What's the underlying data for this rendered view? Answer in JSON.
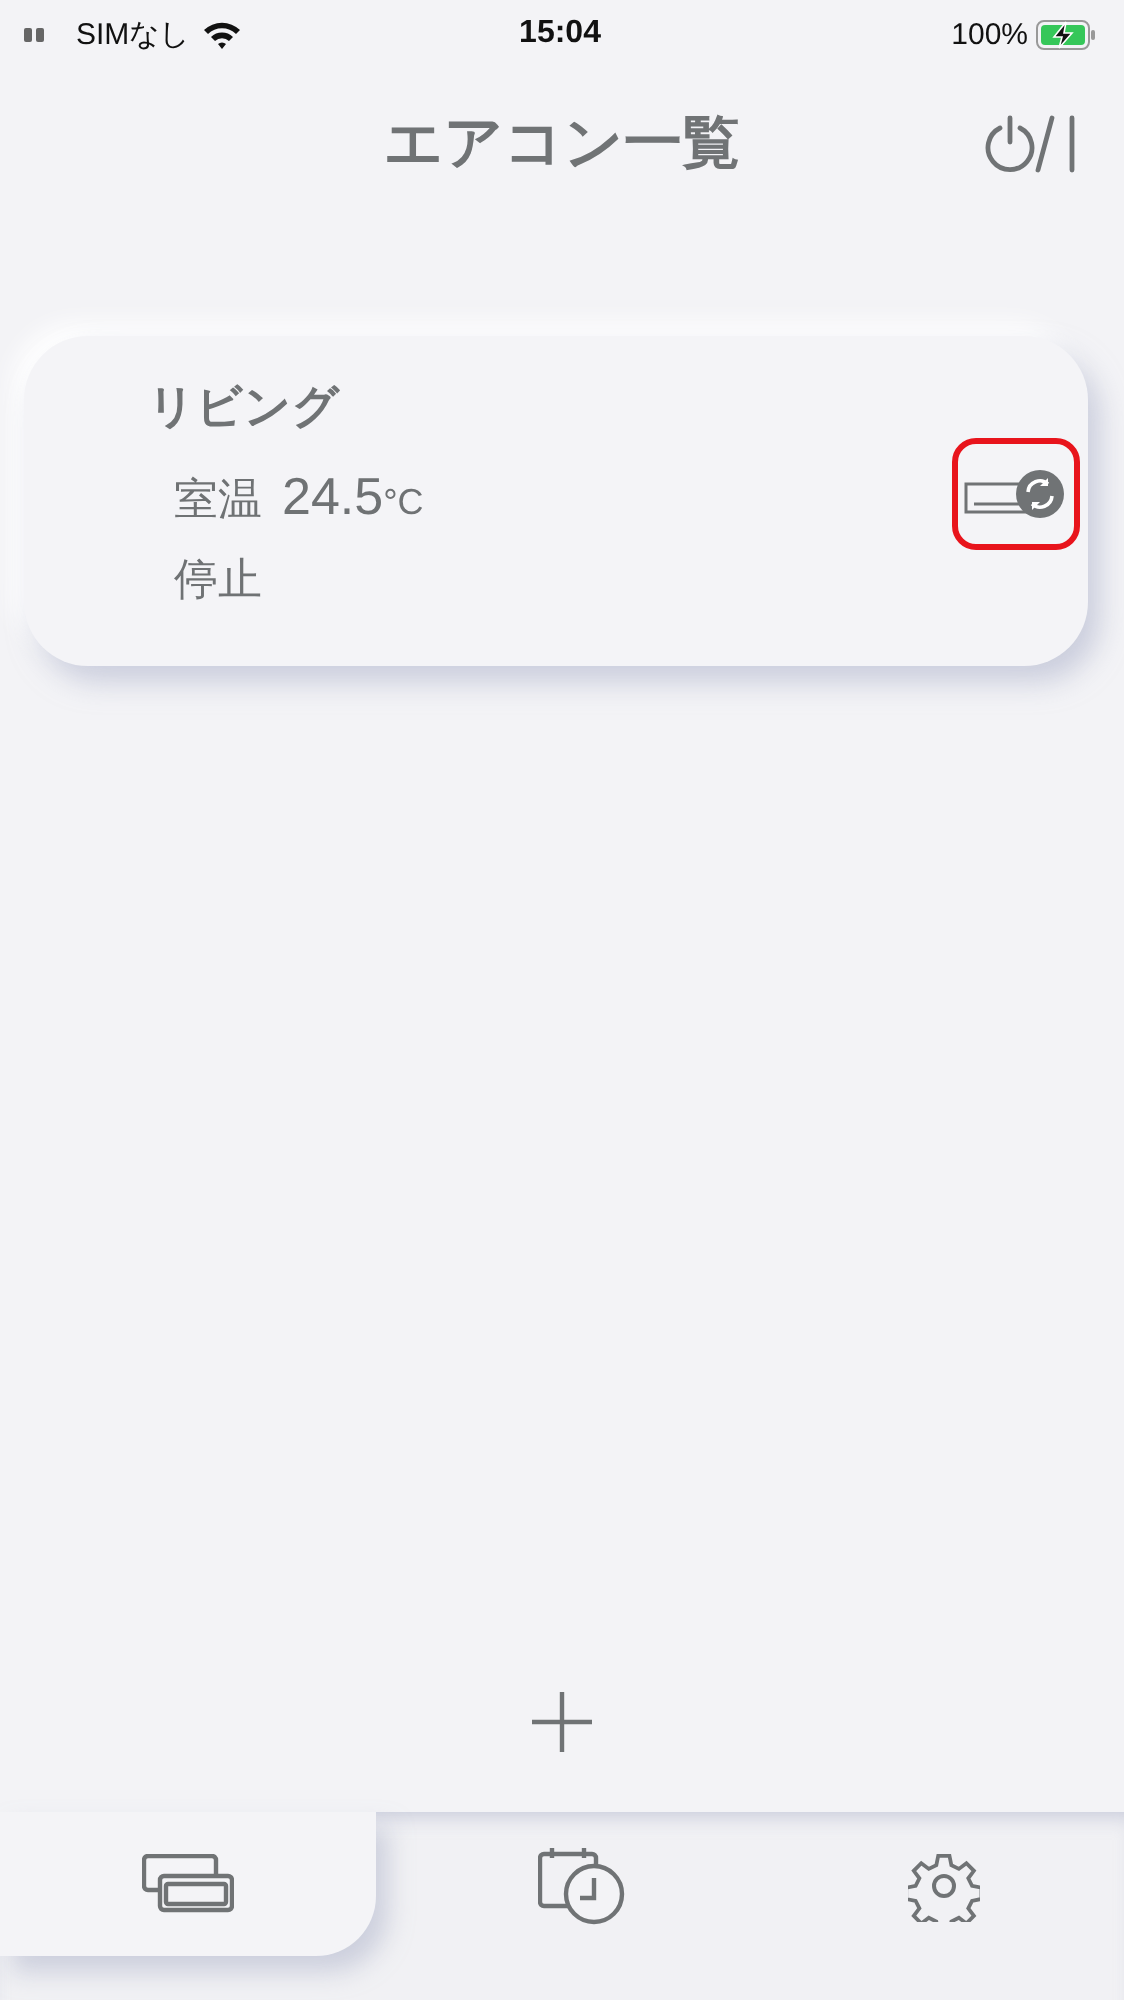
{
  "status_bar": {
    "carrier": "SIMなし",
    "time": "15:04",
    "battery": "100%"
  },
  "header": {
    "title": "エアコン一覧"
  },
  "aircons": [
    {
      "name": "リビング",
      "temp_label": "室温",
      "temp_value": "24.5",
      "temp_unit": "°C",
      "status": "停止",
      "highlighted": true
    }
  ],
  "tabs": [
    {
      "kind": "aircons",
      "selected": true
    },
    {
      "kind": "timer",
      "selected": false
    },
    {
      "kind": "settings",
      "selected": false
    }
  ]
}
